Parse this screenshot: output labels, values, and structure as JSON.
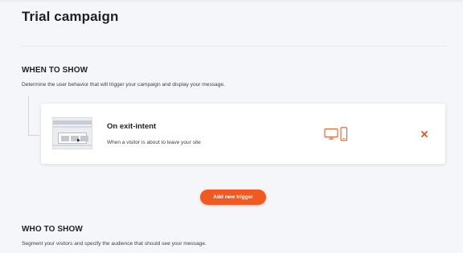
{
  "page": {
    "title": "Trial campaign"
  },
  "when_to_show": {
    "title": "WHEN TO SHOW",
    "description": "Determine the user behavior that will trigger your campaign and display your message."
  },
  "trigger": {
    "title": "On exit-intent",
    "description": "When a visitor is about to leave your site",
    "thumbnail_icon": "exit-intent-preview-icon",
    "device_icons": [
      "desktop-icon",
      "mobile-icon"
    ],
    "remove_icon": "close-icon"
  },
  "actions": {
    "add_trigger_label": "Add new trigger"
  },
  "who_to_show": {
    "title": "WHO TO SHOW",
    "description": "Segment your visitors and specify the audience that should see your message."
  },
  "colors": {
    "accent": "#f05a22",
    "background": "#f4f6f9",
    "card": "#ffffff"
  }
}
